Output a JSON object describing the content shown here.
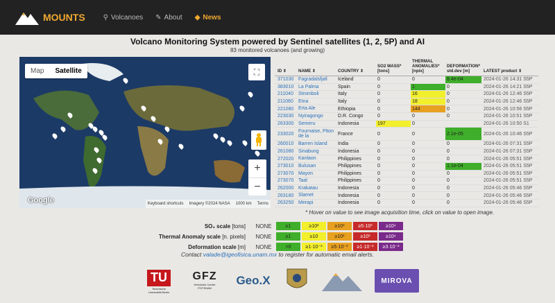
{
  "nav": {
    "brand": "MOUNTS",
    "items": [
      {
        "label": "Volcanoes",
        "icon": "map-marker-icon"
      },
      {
        "label": "About",
        "icon": "pencil-icon"
      },
      {
        "label": "News",
        "icon": "tag-icon"
      }
    ]
  },
  "page": {
    "title": "Volcano Monitoring System powered by Sentinel satellites (1, 2, 5P) and AI",
    "subtitle": "83 monitored volcanoes (and growing)",
    "hover_note": "* Hover on value to see image acquisition time, click on value to open image."
  },
  "map": {
    "type_map": "Map",
    "type_satellite": "Satellite",
    "google": "Google",
    "shortcuts": "Keyboard shortcuts",
    "imagery": "Imagery ©2024 NASA",
    "scale": "1000 km",
    "terms": "Terms"
  },
  "table": {
    "headers": [
      "ID ⇕",
      "NAME ⇕",
      "COUNTRY ⇕",
      "SO2 MASS* [tons]",
      "THERMAL ANOMALIES* [npix]",
      "DEFORMATION* std.dev [m]",
      "LATEST product ⇕"
    ],
    "rows": [
      {
        "id": "371030",
        "name": "Fagradalsfjall",
        "country": "Iceland",
        "so2": "0",
        "thermal": "0",
        "deform": "8.4e-04",
        "latest": "2024-01-26 14:31 S5P"
      },
      {
        "id": "383010",
        "name": "La Palma",
        "country": "Spain",
        "so2": "0",
        "thermal": "1",
        "deform": "0",
        "latest": "2024-01-26 14:21 S5P"
      },
      {
        "id": "211040",
        "name": "Stromboli",
        "country": "Italy",
        "so2": "0",
        "thermal": "16",
        "deform": "0",
        "latest": "2024-01-26 12:46 S5P"
      },
      {
        "id": "211060",
        "name": "Etna",
        "country": "Italy",
        "so2": "0",
        "thermal": "18",
        "deform": "0",
        "latest": "2024-01-26 12:46 S5P"
      },
      {
        "id": "221080",
        "name": "Erta Ale",
        "country": "Ethiopia",
        "so2": "0",
        "thermal": "144",
        "deform": "0",
        "latest": "2024-01-26 10:56 S5P"
      },
      {
        "id": "223030",
        "name": "Nyiragongo",
        "country": "D.R. Congo",
        "so2": "0",
        "thermal": "0",
        "deform": "0",
        "latest": "2024-01-26 10:51 S5P"
      },
      {
        "id": "263300",
        "name": "Semeru",
        "country": "Indonesia",
        "so2": "197",
        "thermal": "0",
        "deform": "",
        "latest": "2024-01-26 10:50 S1"
      },
      {
        "id": "233020",
        "name": "Fournaise, Piton de la",
        "country": "France",
        "so2": "0",
        "thermal": "0",
        "deform": "2.1e-05",
        "latest": "2024-01-26 10:46 S5P"
      },
      {
        "id": "260010",
        "name": "Barren Island",
        "country": "India",
        "so2": "0",
        "thermal": "0",
        "deform": "0",
        "latest": "2024-01-26 07:31 S5P"
      },
      {
        "id": "261080",
        "name": "Sinabung",
        "country": "Indonesia",
        "so2": "0",
        "thermal": "0",
        "deform": "0",
        "latest": "2024-01-26 07:31 S5P"
      },
      {
        "id": "272020",
        "name": "Kanlaon",
        "country": "Philippines",
        "so2": "0",
        "thermal": "0",
        "deform": "0",
        "latest": "2024-01-26 05:51 S5P"
      },
      {
        "id": "273010",
        "name": "Bulusan",
        "country": "Philippines",
        "so2": "0",
        "thermal": "0",
        "deform": "1.1e-04",
        "latest": "2024-01-26 05:51 S5P"
      },
      {
        "id": "273070",
        "name": "Mayon",
        "country": "Philippines",
        "so2": "0",
        "thermal": "0",
        "deform": "0",
        "latest": "2024-01-26 05:51 S5P"
      },
      {
        "id": "273070",
        "name": "Taal",
        "country": "Philippines",
        "so2": "0",
        "thermal": "0",
        "deform": "0",
        "latest": "2024-01-26 05:51 S5P"
      },
      {
        "id": "262000",
        "name": "Krakatau",
        "country": "Indonesia",
        "so2": "0",
        "thermal": "0",
        "deform": "0",
        "latest": "2024-01-26 05:46 S5P"
      },
      {
        "id": "263180",
        "name": "Slamet",
        "country": "Indonesia",
        "so2": "0",
        "thermal": "0",
        "deform": "0",
        "latest": "2024-01-26 05:46 S5P"
      },
      {
        "id": "263250",
        "name": "Merapi",
        "country": "Indonesia",
        "so2": "0",
        "thermal": "0",
        "deform": "0",
        "latest": "2024-01-26 05:46 S5P"
      }
    ],
    "cell_colors": {
      "green": "#3fae2a",
      "yellow": "#f2ef2c",
      "orange": "#e8a020",
      "red_orange": "#e06a2a",
      "red": "#c62a2a",
      "purple": "#7a2a8a"
    }
  },
  "scales": [
    {
      "label": "SO₂ scale",
      "unit": "[tons]",
      "none": "NONE",
      "steps": [
        "≥1",
        "≥10²",
        "≥10³",
        "≥5·10³",
        "≥10⁴"
      ]
    },
    {
      "label": "Thermal Anomaly scale",
      "unit": "[n. pixels]",
      "none": "NONE",
      "steps": [
        "≥1",
        "≥10",
        "≥10²",
        "≥10³",
        "≥10⁴"
      ]
    },
    {
      "label": "Deformation scale",
      "unit": "[m]",
      "none": "NONE",
      "steps": [
        ">0",
        "≥1·10⁻³",
        "≥5·10⁻³",
        "≥1·10⁻²",
        "≥3·10⁻²"
      ]
    }
  ],
  "scale_colors": [
    "#3fae2a",
    "#f2ef2c",
    "#e8a020",
    "#c62a2a",
    "#7a2a8a"
  ],
  "contact": {
    "prefix": "Contact",
    "email": "valade@igeofisica.unam.mx",
    "suffix": "to register for automatic email alerts."
  },
  "logos": {
    "tu_text": "Technische Universität Berlin",
    "gfz": "GFZ",
    "gfz_sub": "Helmholtz Centre POTSDAM",
    "geox": "Geo.X",
    "mirova": "MIROVA"
  }
}
